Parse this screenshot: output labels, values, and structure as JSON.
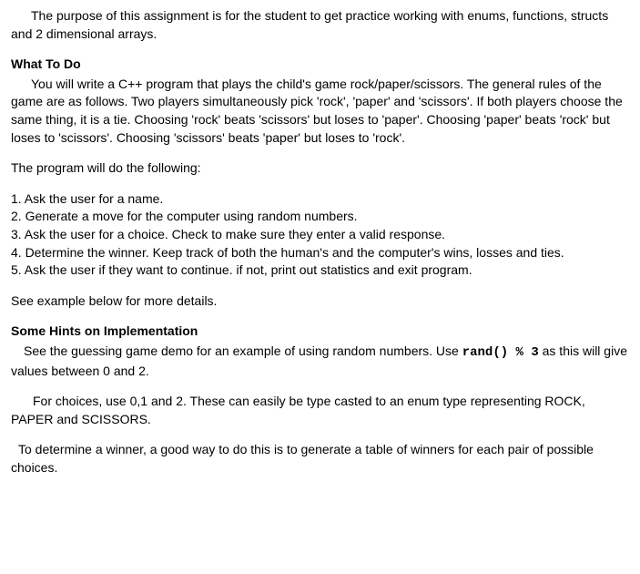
{
  "intro": "The purpose of this assignment is for the student to get practice working with enums, functions, structs and 2 dimensional arrays.",
  "section1": {
    "heading": "What To Do",
    "p1": "You will write a C++ program that plays the child's game rock/paper/scissors.  The general rules of the game are as follows.  Two players simultaneously pick 'rock', 'paper' and 'scissors'.  If both players choose the same thing, it is a tie.  Choosing 'rock' beats 'scissors' but loses to 'paper'.  Choosing 'paper' beats 'rock' but loses to 'scissors'. Choosing 'scissors' beats 'paper' but loses to 'rock'.",
    "p2": "The program will do the following:",
    "steps": [
      "1.  Ask the user for a name.",
      "2.  Generate a move for the computer using random numbers.",
      "3. Ask the user for a choice.  Check to make sure they enter a valid response.",
      "4. Determine the winner.  Keep track of both the human's and the computer's wins, losses and ties.",
      "5.  Ask the user if they want to continue.  if not, print out statistics and exit program."
    ],
    "p3": "See example below for more details."
  },
  "section2": {
    "heading": "Some Hints on Implementation",
    "p1_a": "See the guessing game demo for an example of using random numbers.  Use ",
    "p1_code": "rand() % 3",
    "p1_b": " as this will give values between 0 and 2.",
    "p2": "For choices, use 0,1 and 2.  These can easily be type casted to an enum type representing ROCK, PAPER and SCISSORS.",
    "p3": "To determine a winner, a good way to do this is to generate a table of winners for each pair of possible choices."
  }
}
